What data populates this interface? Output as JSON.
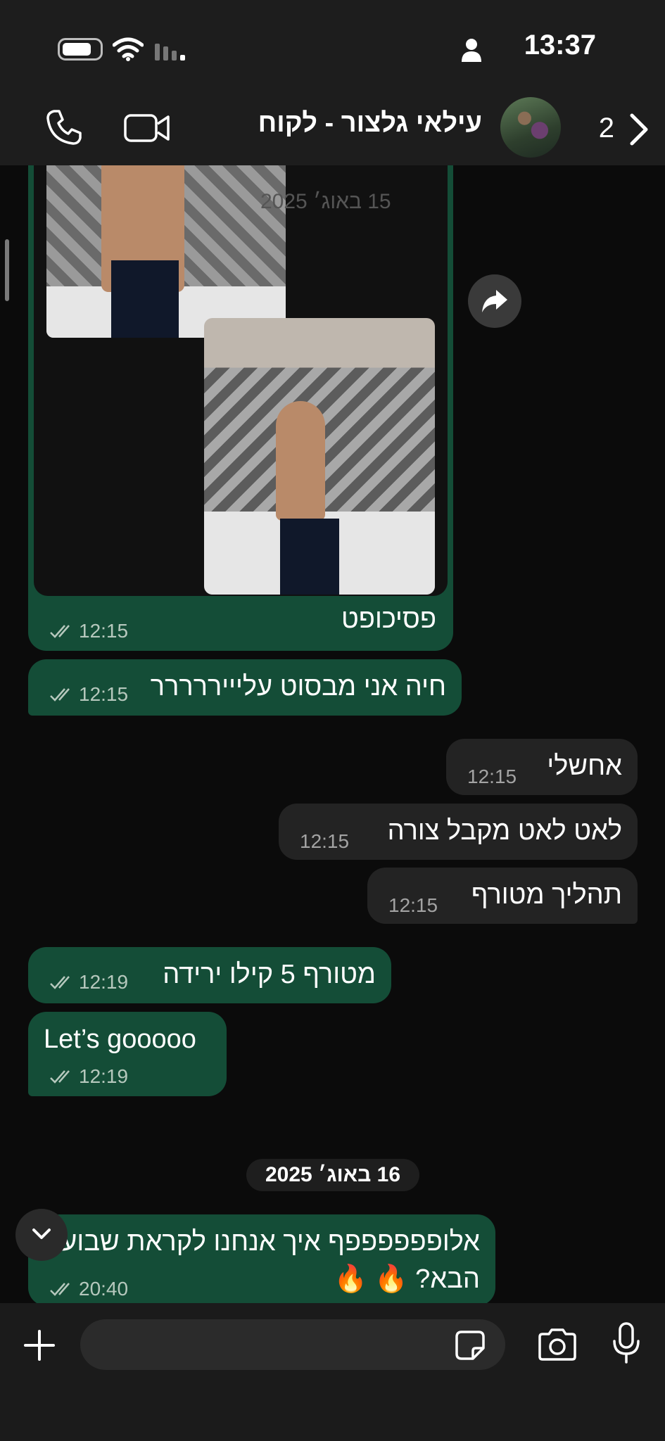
{
  "status_bar": {
    "time": "13:37"
  },
  "header": {
    "back_count": "2",
    "contact_name": "עילאי גלצור - לקוח"
  },
  "media": {
    "date_watermark": "15 באוג׳ 2025"
  },
  "messages": [
    {
      "text": "פסיכופט",
      "time": "12:15"
    },
    {
      "text": "חיה אני מבסוט עליייררררר",
      "time": "12:15"
    },
    {
      "text": "אחשלי",
      "time": "12:15"
    },
    {
      "text": "לאט לאט מקבל צורה",
      "time": "12:15"
    },
    {
      "text": "תהליך מטורף",
      "time": "12:15"
    },
    {
      "text": "מטורף 5 קילו ירידה",
      "time": "12:19"
    },
    {
      "text": "Let’s gooooo",
      "time": "12:19"
    },
    {
      "line1": "אלופפפפפפף איך אנחנו לקראת שבוע",
      "line2": "הבא? 🔥 🔥",
      "time": "20:40"
    }
  ],
  "date_separator": "16 באוג׳ 2025",
  "composer": {
    "placeholder": ""
  },
  "colors": {
    "outgoing_bubble": "#144d37",
    "incoming_bubble": "#232323",
    "background": "#0b0b0b"
  }
}
